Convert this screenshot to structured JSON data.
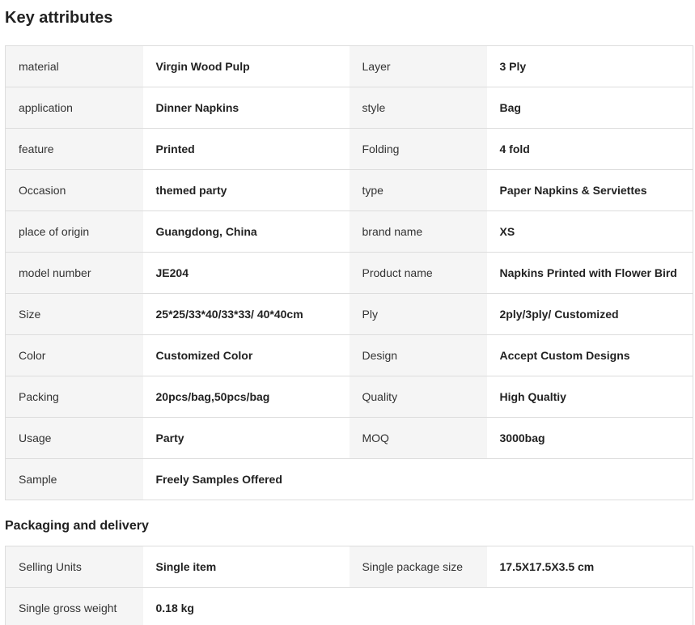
{
  "key_attributes": {
    "title": "Key attributes",
    "rows": [
      {
        "k1": "material",
        "v1": "Virgin Wood Pulp",
        "k2": "Layer",
        "v2": "3 Ply"
      },
      {
        "k1": "application",
        "v1": "Dinner Napkins",
        "k2": "style",
        "v2": "Bag"
      },
      {
        "k1": "feature",
        "v1": "Printed",
        "k2": "Folding",
        "v2": "4 fold"
      },
      {
        "k1": "Occasion",
        "v1": "themed party",
        "k2": "type",
        "v2": "Paper Napkins & Serviettes"
      },
      {
        "k1": "place of origin",
        "v1": "Guangdong, China",
        "k2": "brand name",
        "v2": "XS"
      },
      {
        "k1": "model number",
        "v1": "JE204",
        "k2": "Product name",
        "v2": "Napkins Printed with Flower Bird"
      },
      {
        "k1": "Size",
        "v1": "25*25/33*40/33*33/ 40*40cm",
        "k2": "Ply",
        "v2": "2ply/3ply/ Customized"
      },
      {
        "k1": "Color",
        "v1": "Customized Color",
        "k2": "Design",
        "v2": "Accept Custom Designs"
      },
      {
        "k1": "Packing",
        "v1": "20pcs/bag,50pcs/bag",
        "k2": "Quality",
        "v2": "High Qualtiy"
      },
      {
        "k1": "Usage",
        "v1": "Party",
        "k2": "MOQ",
        "v2": "3000bag"
      },
      {
        "k1": "Sample",
        "v1": "Freely Samples Offered",
        "k2": "",
        "v2": ""
      }
    ]
  },
  "packaging": {
    "title": "Packaging and delivery",
    "rows": [
      {
        "k1": "Selling Units",
        "v1": "Single item",
        "k2": "Single package size",
        "v2": "17.5X17.5X3.5 cm"
      },
      {
        "k1": "Single gross weight",
        "v1": "0.18 kg",
        "k2": "",
        "v2": ""
      }
    ]
  }
}
